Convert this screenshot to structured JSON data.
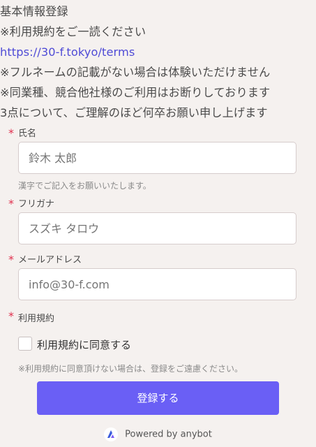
{
  "intro": {
    "title": "基本情報登録",
    "line1": "※利用規約をご一読ください",
    "link": "https://30-f.tokyo/terms",
    "line3": "※フルネームの記載がない場合は体験いただけません",
    "line4": "※同業種、競合他社様のご利用はお断りしております",
    "line5": "3点について、ご理解のほど何卒お願い申し上げます"
  },
  "required_mark": "*",
  "form": {
    "name": {
      "label": "氏名",
      "placeholder": "鈴木 太郎",
      "hint": "漢字でご記入をお願いいたします。"
    },
    "furigana": {
      "label": "フリガナ",
      "placeholder": "スズキ タロウ"
    },
    "email": {
      "label": "メールアドレス",
      "placeholder": "info@30-f.com"
    },
    "terms": {
      "label": "利用規約",
      "checkbox_label": "利用規約に同意する",
      "checked": false,
      "hint": "※利用規約に同意頂けない場合は、登録をご遠慮ください。"
    },
    "submit_label": "登録する"
  },
  "footer": {
    "text": "Powered by anybot",
    "logo_icon": "anybot-logo-icon"
  },
  "colors": {
    "accent": "#6a5ff5",
    "link": "#4f4bd6",
    "required": "#e0304e",
    "background": "#f5f1ef"
  }
}
